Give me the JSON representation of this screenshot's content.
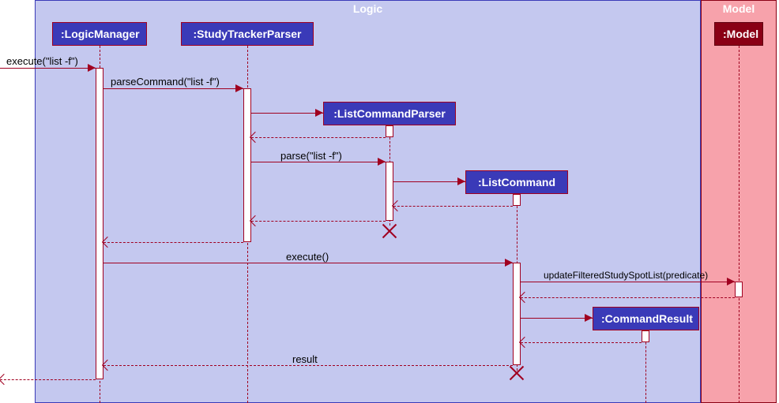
{
  "frames": {
    "logic": {
      "label": "Logic",
      "color_bg": "#c4c8ef",
      "color_border": "#3a3ab8",
      "label_color": "#ffffff"
    },
    "model": {
      "label": "Model",
      "color_bg": "#f7a2ab",
      "color_border": "#8a0015",
      "label_color": "#ffffff"
    }
  },
  "participants": {
    "logicManager": ":LogicManager",
    "studyTrackerParser": ":StudyTrackerParser",
    "listCommandParser": ":ListCommandParser",
    "listCommand": ":ListCommand",
    "commandResult": ":CommandResult",
    "model": ":Model"
  },
  "messages": {
    "m1": "execute(\"list -f\")",
    "m2": "parseCommand(\"list -f\")",
    "m3": "parse(\"list -f\")",
    "m4": "execute()",
    "m5": "updateFilteredStudySpotList(predicate)",
    "m6": "result"
  },
  "chart_data": {
    "type": "sequence_diagram",
    "frames": [
      {
        "name": "Logic",
        "contains": [
          "LogicManager",
          "StudyTrackerParser",
          "ListCommandParser",
          "ListCommand",
          "CommandResult"
        ]
      },
      {
        "name": "Model",
        "contains": [
          "Model"
        ]
      }
    ],
    "participants": [
      {
        "id": "external",
        "name": "(external caller)"
      },
      {
        "id": "LogicManager",
        "name": ":LogicManager"
      },
      {
        "id": "StudyTrackerParser",
        "name": ":StudyTrackerParser"
      },
      {
        "id": "ListCommandParser",
        "name": ":ListCommandParser",
        "created_by": "StudyTrackerParser",
        "destroyed": true
      },
      {
        "id": "ListCommand",
        "name": ":ListCommand",
        "created_by": "ListCommandParser",
        "destroyed": true
      },
      {
        "id": "CommandResult",
        "name": ":CommandResult",
        "created_by": "ListCommand"
      },
      {
        "id": "Model",
        "name": ":Model"
      }
    ],
    "messages": [
      {
        "from": "external",
        "to": "LogicManager",
        "label": "execute(\"list -f\")",
        "type": "sync"
      },
      {
        "from": "LogicManager",
        "to": "StudyTrackerParser",
        "label": "parseCommand(\"list -f\")",
        "type": "sync"
      },
      {
        "from": "StudyTrackerParser",
        "to": "ListCommandParser",
        "label": "",
        "type": "create"
      },
      {
        "from": "ListCommandParser",
        "to": "StudyTrackerParser",
        "label": "",
        "type": "return"
      },
      {
        "from": "StudyTrackerParser",
        "to": "ListCommandParser",
        "label": "parse(\"list -f\")",
        "type": "sync"
      },
      {
        "from": "ListCommandParser",
        "to": "ListCommand",
        "label": "",
        "type": "create"
      },
      {
        "from": "ListCommand",
        "to": "ListCommandParser",
        "label": "",
        "type": "return"
      },
      {
        "from": "ListCommandParser",
        "to": "StudyTrackerParser",
        "label": "",
        "type": "return"
      },
      {
        "from": "ListCommandParser",
        "to": null,
        "label": "",
        "type": "destroy"
      },
      {
        "from": "StudyTrackerParser",
        "to": "LogicManager",
        "label": "",
        "type": "return"
      },
      {
        "from": "LogicManager",
        "to": "ListCommand",
        "label": "execute()",
        "type": "sync"
      },
      {
        "from": "ListCommand",
        "to": "Model",
        "label": "updateFilteredStudySpotList(predicate)",
        "type": "sync"
      },
      {
        "from": "Model",
        "to": "ListCommand",
        "label": "",
        "type": "return"
      },
      {
        "from": "ListCommand",
        "to": "CommandResult",
        "label": "",
        "type": "create"
      },
      {
        "from": "CommandResult",
        "to": "ListCommand",
        "label": "",
        "type": "return"
      },
      {
        "from": "ListCommand",
        "to": "LogicManager",
        "label": "result",
        "type": "return"
      },
      {
        "from": "ListCommand",
        "to": null,
        "label": "",
        "type": "destroy"
      },
      {
        "from": "LogicManager",
        "to": "external",
        "label": "",
        "type": "return"
      }
    ]
  }
}
